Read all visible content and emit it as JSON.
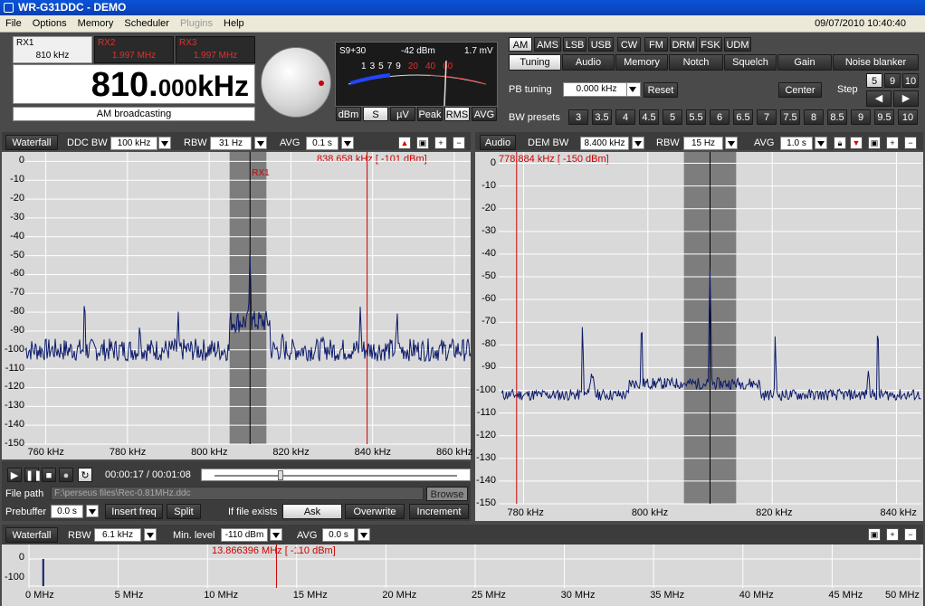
{
  "window": {
    "title": "WR-G31DDC - DEMO"
  },
  "menu": {
    "items": [
      "File",
      "Options",
      "Memory",
      "Scheduler",
      "Plugins",
      "Help"
    ],
    "datetime": "09/07/2010 10:40:40"
  },
  "receivers": {
    "rx1": {
      "label": "RX1",
      "freq": "810 kHz"
    },
    "rx2": {
      "label": "RX2",
      "freq": "1.997 MHz"
    },
    "rx3": {
      "label": "RX3",
      "freq": "1.997 MHz"
    }
  },
  "frequency": {
    "int": "810.",
    "dec": "000",
    "unit": "kHz",
    "band": "AM broadcasting"
  },
  "smeter": {
    "level": "S9+30",
    "dbm": "-42 dBm",
    "mv": "1.7 mV",
    "scale": [
      "1",
      "3",
      "5",
      "7",
      "9",
      "20",
      "40",
      "60"
    ],
    "buttons": [
      "dBm",
      "S",
      "µV",
      "Peak",
      "RMS",
      "AVG"
    ]
  },
  "modes": [
    "AM",
    "AMS",
    "LSB",
    "USB",
    "CW",
    "FM",
    "DRM",
    "FSK",
    "UDM"
  ],
  "tabs": [
    "Tuning",
    "Audio",
    "Memory",
    "Notch",
    "Squelch",
    "Gain",
    "Noise blanker"
  ],
  "tuning": {
    "pb_label": "PB tuning",
    "pb_value": "0.000 kHz",
    "reset": "Reset",
    "center": "Center",
    "step_label": "Step",
    "steps": [
      "5",
      "9",
      "10"
    ]
  },
  "bw_presets": {
    "label": "BW presets",
    "values": [
      "3",
      "3.5",
      "4",
      "4.5",
      "5",
      "5.5",
      "6",
      "6.5",
      "7",
      "7.5",
      "8",
      "8.5",
      "9",
      "9.5",
      "10"
    ]
  },
  "ddc_panel": {
    "waterfall": "Waterfall",
    "ddc_bw_label": "DDC BW",
    "ddc_bw": "100 kHz",
    "rbw_label": "RBW",
    "rbw": "31 Hz",
    "avg_label": "AVG",
    "avg": "0.1 s",
    "cursor": "838.658 kHz [ -101 dBm]",
    "rx_marker": "RX1",
    "y_ticks": [
      "0",
      "-10",
      "-20",
      "-30",
      "-40",
      "-50",
      "-60",
      "-70",
      "-80",
      "-90",
      "-100",
      "-110",
      "-120",
      "-130",
      "-140",
      "-150"
    ],
    "x_ticks": [
      "760 kHz",
      "780 kHz",
      "800 kHz",
      "820 kHz",
      "840 kHz",
      "860 kHz"
    ]
  },
  "demod_panel": {
    "audio": "Audio",
    "dem_bw_label": "DEM BW",
    "dem_bw": "8.400 kHz",
    "rbw_label": "RBW",
    "rbw": "15 Hz",
    "avg_label": "AVG",
    "avg": "1.0 s",
    "cursor": "778.884 kHz [ -150 dBm]",
    "y_ticks": [
      "0",
      "-10",
      "-20",
      "-30",
      "-40",
      "-50",
      "-60",
      "-70",
      "-80",
      "-90",
      "-100",
      "-110",
      "-120",
      "-130",
      "-140",
      "-150"
    ],
    "x_ticks": [
      "780 kHz",
      "800 kHz",
      "820 kHz",
      "840 kHz"
    ]
  },
  "recorder": {
    "time": "00:00:17 / 00:01:08",
    "filepath_label": "File path",
    "filepath": "F:\\perseus files\\Rec-0.81MHz.ddc",
    "browse": "Browse",
    "prebuffer_label": "Prebuffer",
    "prebuffer": "0.0 s",
    "insert": "Insert freq",
    "split": "Split",
    "exists_label": "If file exists",
    "ask": "Ask",
    "overwrite": "Overwrite",
    "increment": "Increment"
  },
  "wideband": {
    "waterfall": "Waterfall",
    "rbw_label": "RBW",
    "rbw": "6.1 kHz",
    "min_label": "Min. level",
    "min": "-110 dBm",
    "avg_label": "AVG",
    "avg": "0.0 s",
    "cursor": "13.866396 MHz [ -110 dBm]",
    "y_ticks": [
      "0",
      "-100"
    ],
    "x_ticks": [
      "0 MHz",
      "5 MHz",
      "10 MHz",
      "15 MHz",
      "20 MHz",
      "25 MHz",
      "30 MHz",
      "35 MHz",
      "40 MHz",
      "45 MHz",
      "50 MHz"
    ]
  },
  "colors": {
    "trace": "#0c1a6a",
    "cursor": "#cc0000",
    "band": "#7d7d7d",
    "plot_bg": "#d9d9d9"
  }
}
